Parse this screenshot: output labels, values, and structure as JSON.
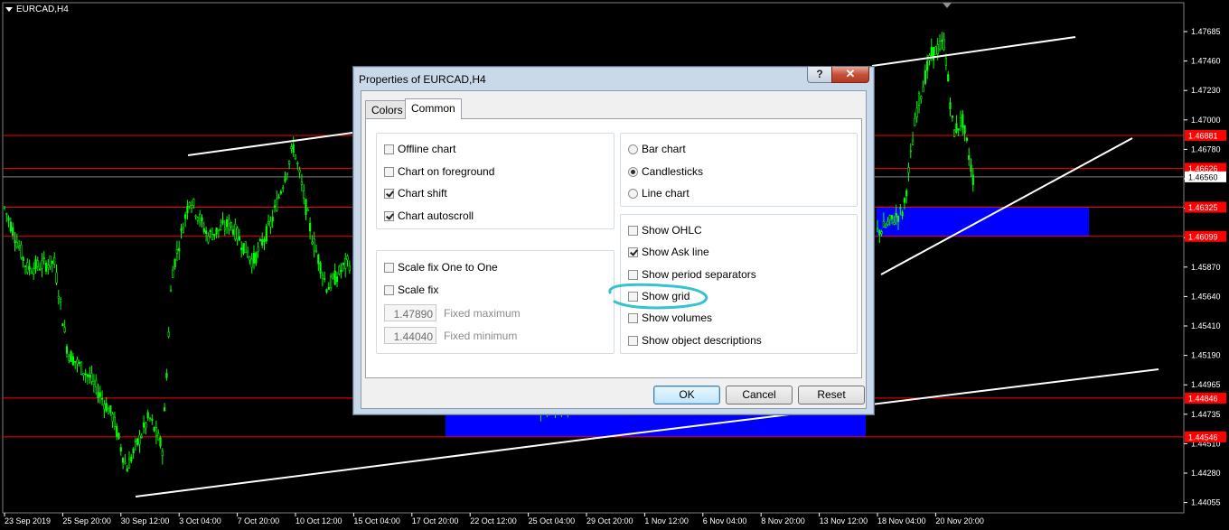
{
  "chart": {
    "title": "EURCAD,H4",
    "price_labels": [
      "1.47685",
      "1.47460",
      "1.47230",
      "1.47000",
      "1.46780",
      "1.46550",
      "1.46325",
      "1.46099",
      "1.45870",
      "1.45640",
      "1.45410",
      "1.45190",
      "1.44965",
      "1.44735",
      "1.44510",
      "1.44280",
      "1.44055"
    ],
    "marked_prices": [
      {
        "label": "1.46881",
        "y_value": 1.46881,
        "color": "#ff0000"
      },
      {
        "label": "1.46626",
        "y_value": 1.46626,
        "color": "#ff0000"
      },
      {
        "label": "1.46325",
        "y_value": 1.46325,
        "color": "#ff0000"
      },
      {
        "label": "1.46099",
        "y_value": 1.46099,
        "color": "#ff0000"
      },
      {
        "label": "1.44846",
        "y_value": 1.44846,
        "color": "#ff0000"
      },
      {
        "label": "1.44546",
        "y_value": 1.44546,
        "color": "#ff0000"
      }
    ],
    "current_price": {
      "label": "1.46560",
      "y_value": 1.4656
    },
    "time_labels": [
      "23 Sep 2019",
      "25 Sep 20:00",
      "30 Sep 12:00",
      "3 Oct 04:00",
      "7 Oct 20:00",
      "10 Oct 12:00",
      "15 Oct 04:00",
      "17 Oct 20:00",
      "22 Oct 12:00",
      "25 Oct 04:00",
      "29 Oct 20:00",
      "1 Nov 12:00",
      "6 Nov 04:00",
      "8 Nov 20:00",
      "13 Nov 12:00",
      "18 Nov 04:00",
      "20 Nov 20:00"
    ],
    "colors": {
      "background": "#000000",
      "candles": "#00ff00",
      "level_lines": "#ff0000",
      "trend_lines": "#ffffff",
      "zones": "#0000ff",
      "label_bg": "#ff0000"
    }
  },
  "dialog": {
    "title": "Properties of EURCAD,H4",
    "help_label": "?",
    "close_label": "✕",
    "tabs": [
      {
        "label": "Colors",
        "active": false
      },
      {
        "label": "Common",
        "active": true
      }
    ],
    "options_left": [
      {
        "label": "Offline chart",
        "checked": false
      },
      {
        "label": "Chart on foreground",
        "checked": false
      },
      {
        "label": "Chart shift",
        "checked": true
      },
      {
        "label": "Chart autoscroll",
        "checked": true
      }
    ],
    "scale_options": [
      {
        "label": "Scale fix One to One",
        "checked": false
      },
      {
        "label": "Scale fix",
        "checked": false
      }
    ],
    "fixed_maximum": {
      "value": "1.47890",
      "label": "Fixed maximum"
    },
    "fixed_minimum": {
      "value": "1.44040",
      "label": "Fixed minimum"
    },
    "chart_types": [
      {
        "label": "Bar chart",
        "checked": false
      },
      {
        "label": "Candlesticks",
        "checked": true
      },
      {
        "label": "Line chart",
        "checked": false
      }
    ],
    "show_options": [
      {
        "label": "Show OHLC",
        "checked": false
      },
      {
        "label": "Show Ask line",
        "checked": true
      },
      {
        "label": "Show period separators",
        "checked": false
      },
      {
        "label": "Show grid",
        "checked": false
      },
      {
        "label": "Show volumes",
        "checked": false
      },
      {
        "label": "Show object descriptions",
        "checked": false
      }
    ],
    "buttons": {
      "ok": "OK",
      "cancel": "Cancel",
      "reset": "Reset"
    },
    "annotation_color": "#35c3cf"
  }
}
